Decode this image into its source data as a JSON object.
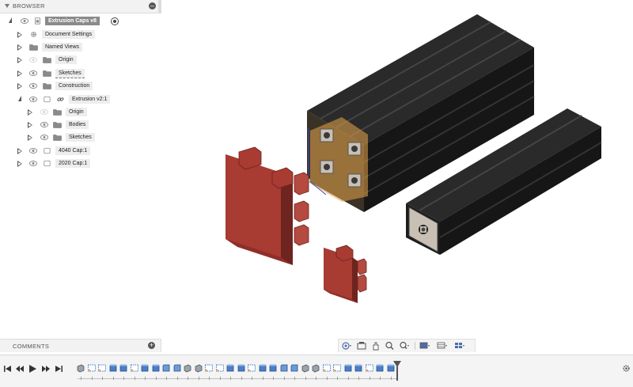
{
  "browser": {
    "title": "BROWSER",
    "items": [
      {
        "label": "Extrusion Caps v8",
        "icon": "document-icon"
      },
      {
        "label": "Document Settings",
        "icon": "gear-icon"
      },
      {
        "label": "Named Views",
        "icon": "folder-icon"
      },
      {
        "label": "Origin",
        "icon": "folder-icon"
      },
      {
        "label": "Sketches",
        "icon": "folder-icon"
      },
      {
        "label": "Construction",
        "icon": "folder-icon"
      },
      {
        "label": "Extrusion v2:1",
        "icon": "linked-component-icon"
      },
      {
        "label": "Origin",
        "icon": "folder-icon"
      },
      {
        "label": "Bodies",
        "icon": "folder-icon"
      },
      {
        "label": "Sketches",
        "icon": "folder-icon"
      },
      {
        "label": "4040 Cap:1",
        "icon": "component-icon"
      },
      {
        "label": "2020 Cap:1",
        "icon": "component-icon"
      }
    ]
  },
  "comments": {
    "title": "COMMENTS"
  },
  "nav_toolbar": {
    "buttons": [
      "orbit-icon",
      "look-at-icon",
      "pan-icon",
      "zoom-icon",
      "fit-icon",
      "display-settings-icon",
      "grid-settings-icon",
      "viewports-icon"
    ]
  },
  "timeline": {
    "controls": [
      "skip-to-start-icon",
      "step-back-icon",
      "play-icon",
      "step-forward-icon",
      "skip-to-end-icon"
    ],
    "feature_count": 30
  },
  "colors": {
    "cap_red": "#a83b32",
    "extrusion_black": "#1c1c1c",
    "selection_orange": "#e8a54a",
    "root_label_bg": "#8a8a8a"
  }
}
